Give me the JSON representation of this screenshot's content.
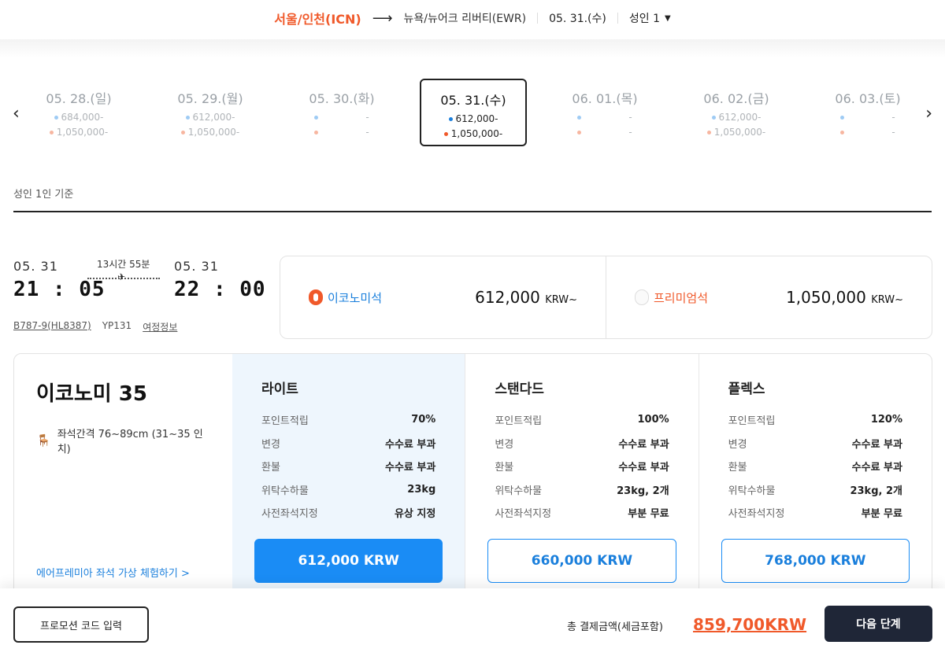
{
  "route": {
    "origin": "서울/인천(ICN)",
    "arrow": "⟶",
    "destination": "뉴욕/뉴어크 리버티(EWR)",
    "date": "05. 31.(수)",
    "passengers": "성인 1"
  },
  "date_strip": [
    {
      "date": "05. 28.(일)",
      "economy": "684,000-",
      "premium": "1,050,000-"
    },
    {
      "date": "05. 29.(월)",
      "economy": "612,000-",
      "premium": "1,050,000-"
    },
    {
      "date": "05. 30.(화)",
      "economy": "-",
      "premium": "-"
    },
    {
      "date": "05. 31.(수)",
      "economy": "612,000-",
      "premium": "1,050,000-"
    },
    {
      "date": "06. 01.(목)",
      "economy": "-",
      "premium": "-"
    },
    {
      "date": "06. 02.(금)",
      "economy": "612,000-",
      "premium": "1,050,000-"
    },
    {
      "date": "06. 03.(토)",
      "economy": "-",
      "premium": "-"
    }
  ],
  "selected_date_index": 3,
  "basis_label": "성인 1인 기준",
  "flight": {
    "dep_date": "05. 31",
    "dep_time": "21 : 05",
    "arr_date": "05. 31",
    "arr_time": "22 : 00",
    "duration": "13시간 55분",
    "aircraft": "B787-9(HL8387)",
    "flight_no": "YP131",
    "itinerary_link": "여정정보"
  },
  "cabins": [
    {
      "name": "이코노미석",
      "price": "612,000",
      "currency": "KRW~"
    },
    {
      "name": "프리미엄석",
      "price": "1,050,000",
      "currency": "KRW~"
    }
  ],
  "fare_panel": {
    "title": "이코노미 35",
    "seat_pitch": "좌석간격 76~89cm (31~35 인치)",
    "vr_link": "에어프레미아 좌석 가상 체험하기 >",
    "columns": [
      {
        "name": "라이트",
        "price": "612,000 KRW",
        "rows": [
          [
            "포인트적립",
            "70%"
          ],
          [
            "변경",
            "수수료 부과"
          ],
          [
            "환불",
            "수수료 부과"
          ],
          [
            "위탁수하물",
            "23kg"
          ],
          [
            "사전좌석지정",
            "유상 지정"
          ]
        ]
      },
      {
        "name": "스탠다드",
        "price": "660,000 KRW",
        "rows": [
          [
            "포인트적립",
            "100%"
          ],
          [
            "변경",
            "수수료 부과"
          ],
          [
            "환불",
            "수수료 부과"
          ],
          [
            "위탁수하물",
            "23kg, 2개"
          ],
          [
            "사전좌석지정",
            "부분 무료"
          ]
        ]
      },
      {
        "name": "플렉스",
        "price": "768,000 KRW",
        "rows": [
          [
            "포인트적립",
            "120%"
          ],
          [
            "변경",
            "수수료 부과"
          ],
          [
            "환불",
            "수수료 부과"
          ],
          [
            "위탁수하물",
            "23kg, 2개"
          ],
          [
            "사전좌석지정",
            "부분 무료"
          ]
        ]
      }
    ]
  },
  "bottom": {
    "promo": "프로모션 코드 입력",
    "total_label": "총 결제금액(세금포함)",
    "total": "859,700KRW",
    "next": "다음 단계"
  },
  "colors": {
    "accent_orange": "#f0592a",
    "accent_blue": "#1a8cf5",
    "dark_button": "#1f2637"
  }
}
